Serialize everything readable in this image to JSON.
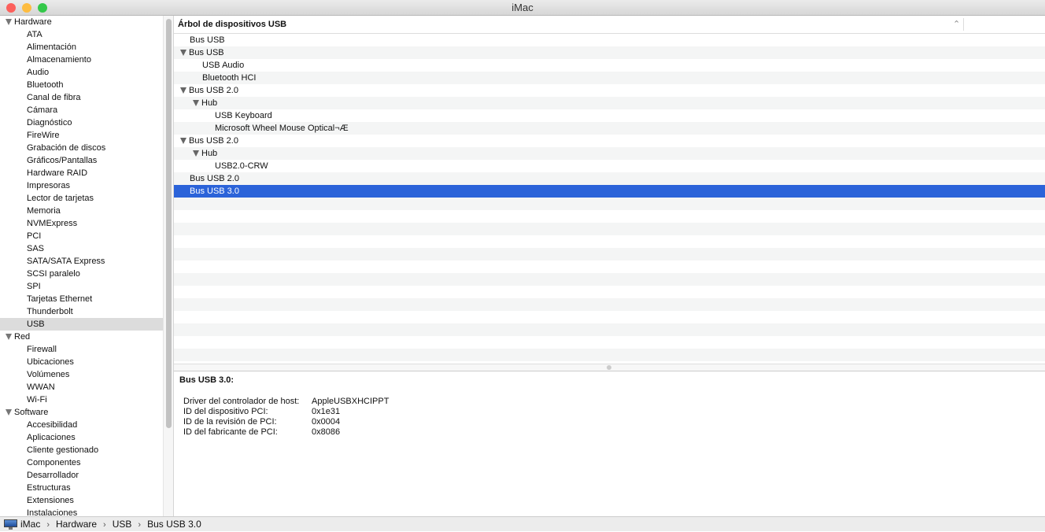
{
  "window": {
    "title": "iMac"
  },
  "sidebar": {
    "items": [
      {
        "label": "Hardware",
        "level": 0,
        "expanded": true
      },
      {
        "label": "ATA",
        "level": 1
      },
      {
        "label": "Alimentación",
        "level": 1
      },
      {
        "label": "Almacenamiento",
        "level": 1
      },
      {
        "label": "Audio",
        "level": 1
      },
      {
        "label": "Bluetooth",
        "level": 1
      },
      {
        "label": "Canal de fibra",
        "level": 1
      },
      {
        "label": "Cámara",
        "level": 1
      },
      {
        "label": "Diagnóstico",
        "level": 1
      },
      {
        "label": "FireWire",
        "level": 1
      },
      {
        "label": "Grabación de discos",
        "level": 1
      },
      {
        "label": "Gráficos/Pantallas",
        "level": 1
      },
      {
        "label": "Hardware RAID",
        "level": 1
      },
      {
        "label": "Impresoras",
        "level": 1
      },
      {
        "label": "Lector de tarjetas",
        "level": 1
      },
      {
        "label": "Memoria",
        "level": 1
      },
      {
        "label": "NVMExpress",
        "level": 1
      },
      {
        "label": "PCI",
        "level": 1
      },
      {
        "label": "SAS",
        "level": 1
      },
      {
        "label": "SATA/SATA Express",
        "level": 1
      },
      {
        "label": "SCSI paralelo",
        "level": 1
      },
      {
        "label": "SPI",
        "level": 1
      },
      {
        "label": "Tarjetas Ethernet",
        "level": 1
      },
      {
        "label": "Thunderbolt",
        "level": 1
      },
      {
        "label": "USB",
        "level": 1,
        "selected": true
      },
      {
        "label": "Red",
        "level": 0,
        "expanded": true
      },
      {
        "label": "Firewall",
        "level": 1
      },
      {
        "label": "Ubicaciones",
        "level": 1
      },
      {
        "label": "Volúmenes",
        "level": 1
      },
      {
        "label": "WWAN",
        "level": 1
      },
      {
        "label": "Wi-Fi",
        "level": 1
      },
      {
        "label": "Software",
        "level": 0,
        "expanded": true
      },
      {
        "label": "Accesibilidad",
        "level": 1
      },
      {
        "label": "Aplicaciones",
        "level": 1
      },
      {
        "label": "Cliente gestionado",
        "level": 1
      },
      {
        "label": "Componentes",
        "level": 1
      },
      {
        "label": "Desarrollador",
        "level": 1
      },
      {
        "label": "Estructuras",
        "level": 1
      },
      {
        "label": "Extensiones",
        "level": 1
      },
      {
        "label": "Instalaciones",
        "level": 1
      }
    ]
  },
  "tree": {
    "header": "Árbol de dispositivos USB",
    "rows": [
      {
        "label": "Bus USB",
        "level": 0,
        "expander": false
      },
      {
        "label": "Bus USB",
        "level": 0,
        "expander": true
      },
      {
        "label": "USB Audio",
        "level": 1,
        "expander": false
      },
      {
        "label": "Bluetooth HCI",
        "level": 1,
        "expander": false
      },
      {
        "label": "Bus USB 2.0",
        "level": 0,
        "expander": true
      },
      {
        "label": "Hub",
        "level": 1,
        "expander": true
      },
      {
        "label": "USB Keyboard",
        "level": 2,
        "expander": false
      },
      {
        "label": "Microsoft Wheel Mouse Optical¬Æ",
        "level": 2,
        "expander": false
      },
      {
        "label": "Bus USB 2.0",
        "level": 0,
        "expander": true
      },
      {
        "label": "Hub",
        "level": 1,
        "expander": true
      },
      {
        "label": "USB2.0-CRW",
        "level": 2,
        "expander": false
      },
      {
        "label": "Bus USB 2.0",
        "level": 0,
        "expander": false
      },
      {
        "label": "Bus USB 3.0",
        "level": 0,
        "expander": false,
        "selected": true
      }
    ]
  },
  "detail": {
    "title": "Bus USB 3.0:",
    "fields": [
      {
        "key": "Driver del controlador de host:",
        "value": "AppleUSBXHCIPPT"
      },
      {
        "key": "ID del dispositivo PCI:",
        "value": "0x1e31"
      },
      {
        "key": "ID de la revisión de PCI:",
        "value": "0x0004"
      },
      {
        "key": "ID del fabricante de PCI:",
        "value": "0x8086"
      }
    ]
  },
  "status": {
    "path": [
      "iMac",
      "Hardware",
      "USB",
      "Bus USB 3.0"
    ],
    "separator": "›"
  },
  "colors": {
    "selection": "#2b63d9",
    "close": "#fc605c",
    "minimize": "#fdbc40",
    "zoom": "#34c84a"
  }
}
